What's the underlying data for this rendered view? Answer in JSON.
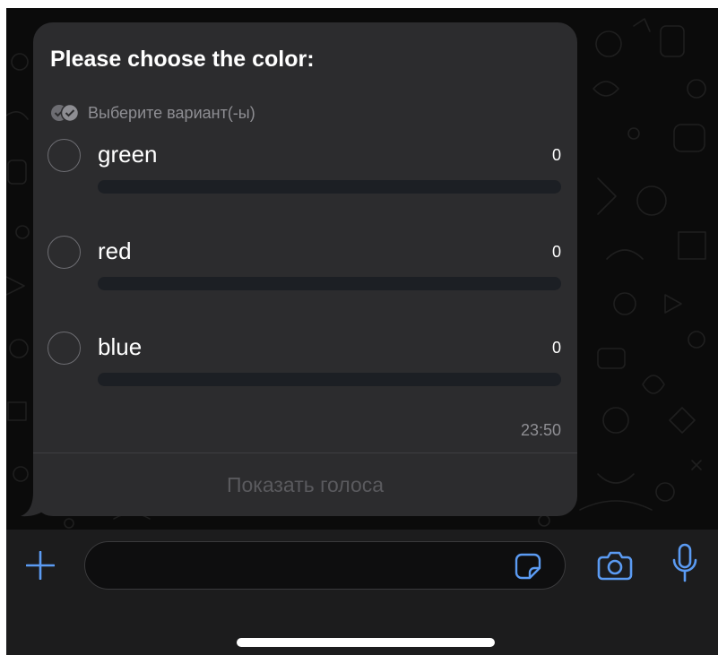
{
  "poll": {
    "question": "Please choose the color:",
    "type_label": "Выберите вариант(-ы)",
    "options": [
      {
        "label": "green",
        "votes": "0",
        "fraction": 0
      },
      {
        "label": "red",
        "votes": "0",
        "fraction": 0
      },
      {
        "label": "blue",
        "votes": "0",
        "fraction": 0
      }
    ],
    "timestamp": "23:50",
    "show_votes_label": "Показать голоса"
  },
  "composer": {
    "input_value": "",
    "attach_icon": "plus-icon",
    "sticker_icon": "sticker-icon",
    "camera_icon": "camera-icon",
    "mic_icon": "microphone-icon"
  },
  "colors": {
    "accent": "#5b9bf3",
    "bubble": "#2c2c2e",
    "background": "#0b0b0b"
  }
}
